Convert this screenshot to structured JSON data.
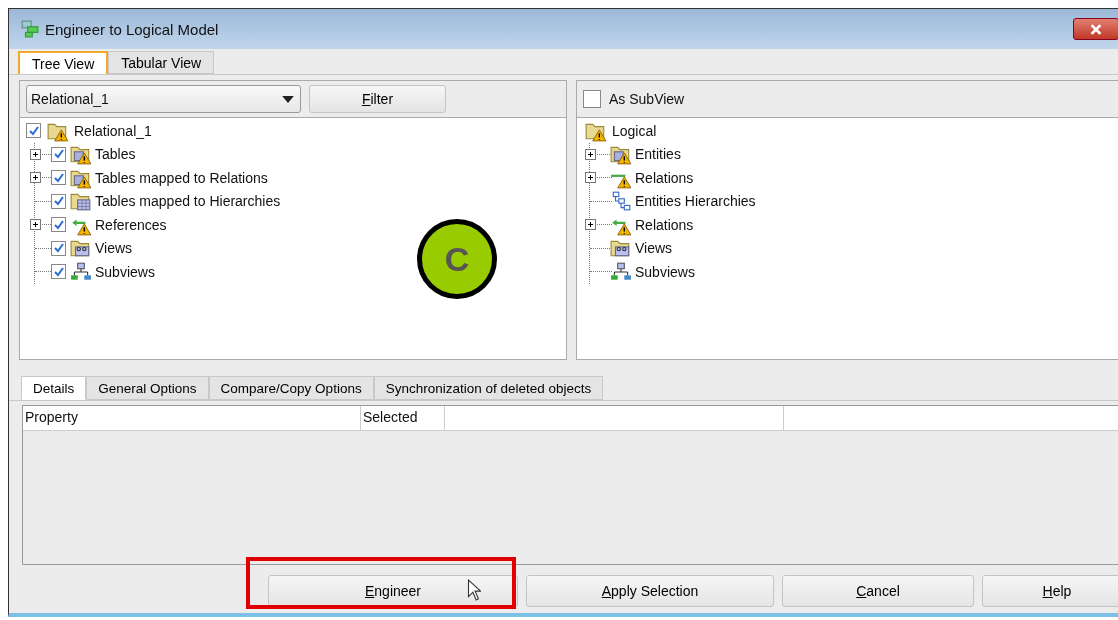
{
  "window": {
    "title": "Engineer to Logical Model"
  },
  "view_tabs": [
    {
      "label": "Tree View",
      "selected": true
    },
    {
      "label": "Tabular View",
      "selected": false
    }
  ],
  "left_panel": {
    "model_select": {
      "value": "Relational_1"
    },
    "filter_button": {
      "label": "Filter",
      "mnemonic": true
    },
    "tree": {
      "label": "Relational_1",
      "kind": "folder-warning",
      "checked": true,
      "children": [
        {
          "label": "Tables",
          "kind": "table-folder-warning",
          "checked": true,
          "expandable": true
        },
        {
          "label": "Tables mapped to Relations",
          "kind": "table-folder-warning",
          "checked": true,
          "expandable": true
        },
        {
          "label": "Tables mapped to Hierarchies",
          "kind": "table-folder",
          "checked": true,
          "expandable": false
        },
        {
          "label": "References",
          "kind": "reference-warning",
          "checked": true,
          "expandable": true
        },
        {
          "label": "Views",
          "kind": "views-folder",
          "checked": true,
          "expandable": false
        },
        {
          "label": "Subviews",
          "kind": "subviews",
          "checked": true,
          "expandable": false
        }
      ]
    }
  },
  "right_panel": {
    "as_subview": {
      "label": "As SubView",
      "checked": false
    },
    "tree": {
      "label": "Logical",
      "kind": "folder-warning",
      "children": [
        {
          "label": "Entities",
          "kind": "table-folder-warning",
          "expandable": true
        },
        {
          "label": "Relations",
          "kind": "relation-warning",
          "expandable": true
        },
        {
          "label": "Entities Hierarchies",
          "kind": "hierarchy",
          "expandable": false
        },
        {
          "label": "Relations",
          "kind": "reference-warning",
          "expandable": true
        },
        {
          "label": "Views",
          "kind": "views-folder",
          "expandable": false
        },
        {
          "label": "Subviews",
          "kind": "subviews",
          "expandable": false
        }
      ]
    }
  },
  "callout": {
    "label": "C"
  },
  "detail_tabs": [
    {
      "label": "Details",
      "selected": true
    },
    {
      "label": "General Options",
      "selected": false
    },
    {
      "label": "Compare/Copy Options",
      "selected": false
    },
    {
      "label": "Synchronization of deleted objects",
      "selected": false
    }
  ],
  "table": {
    "columns": [
      "Property",
      "Selected"
    ]
  },
  "buttons": [
    {
      "label": "Engineer",
      "mnemonic": true,
      "highlighted": true
    },
    {
      "label": "Apply Selection",
      "mnemonic": true,
      "highlighted": false
    },
    {
      "label": "Cancel",
      "mnemonic": true,
      "highlighted": false
    },
    {
      "label": "Help",
      "mnemonic": true,
      "highlighted": false
    }
  ]
}
